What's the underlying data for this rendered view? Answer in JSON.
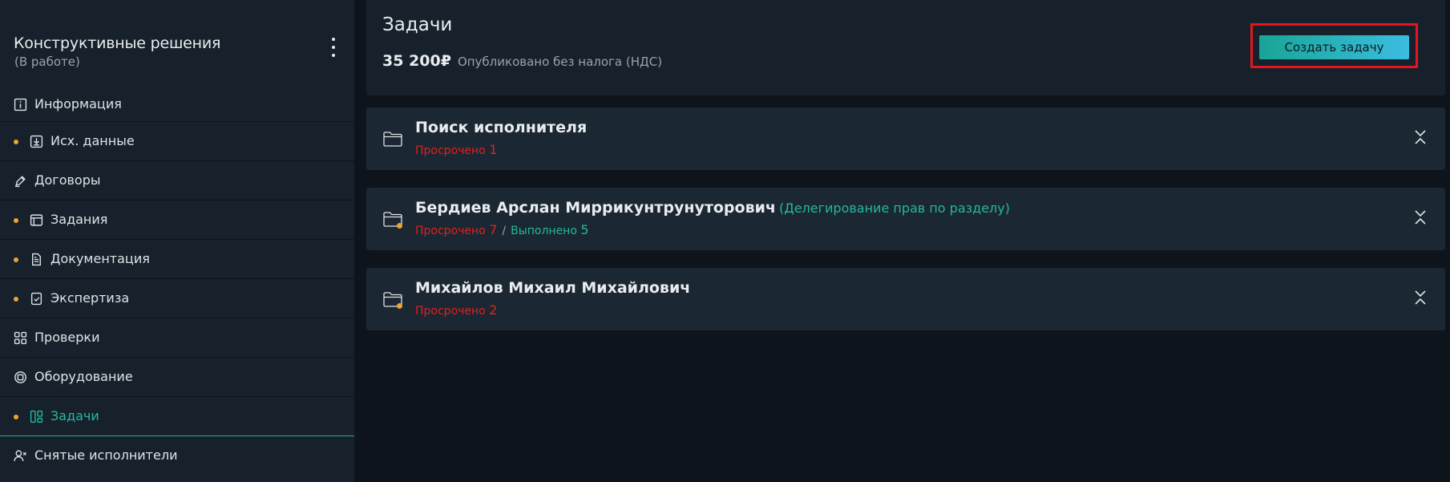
{
  "project": {
    "title": "Конструктивные решения",
    "status": "(В работе)"
  },
  "sidebar": {
    "items": [
      {
        "label": "Информация",
        "icon": "info-icon"
      },
      {
        "label": "Исх. данные",
        "icon": "download-icon",
        "dot": true
      },
      {
        "label": "Договоры",
        "icon": "pen-icon"
      },
      {
        "label": "Задания",
        "icon": "window-icon",
        "dot": true
      },
      {
        "label": "Документация",
        "icon": "document-icon",
        "dot": true
      },
      {
        "label": "Экспертиза",
        "icon": "checklist-icon",
        "dot": true
      },
      {
        "label": "Проверки",
        "icon": "grid-icon"
      },
      {
        "label": "Оборудование",
        "icon": "chip-icon"
      },
      {
        "label": "Задачи",
        "icon": "layout-icon",
        "dot": true,
        "active": true
      },
      {
        "label": "Снятые исполнители",
        "icon": "user-remove-icon"
      }
    ]
  },
  "header": {
    "title": "Задачи",
    "price": "35 200₽",
    "price_note": "Опубликовано без налога (НДС)",
    "create_button": "Создать задачу"
  },
  "groups": [
    {
      "title": "Поиск исполнителя",
      "overdue_label": "Просрочено",
      "overdue_count": "1"
    },
    {
      "title": "Бердиев Арслан Миррикунтрунуторович",
      "subtitle": "(Делегирование прав по разделу)",
      "overdue_label": "Просрочено",
      "overdue_count": "7",
      "separator": "/",
      "done_label": "Выполнено",
      "done_count": "5"
    },
    {
      "title": "Михайлов Михаил Михайлович",
      "overdue_label": "Просрочено",
      "overdue_count": "2"
    }
  ],
  "colors": {
    "accent": "#22b8a0",
    "overdue": "#e0201f",
    "dot": "#f0a330",
    "highlight": "#e8141c"
  }
}
